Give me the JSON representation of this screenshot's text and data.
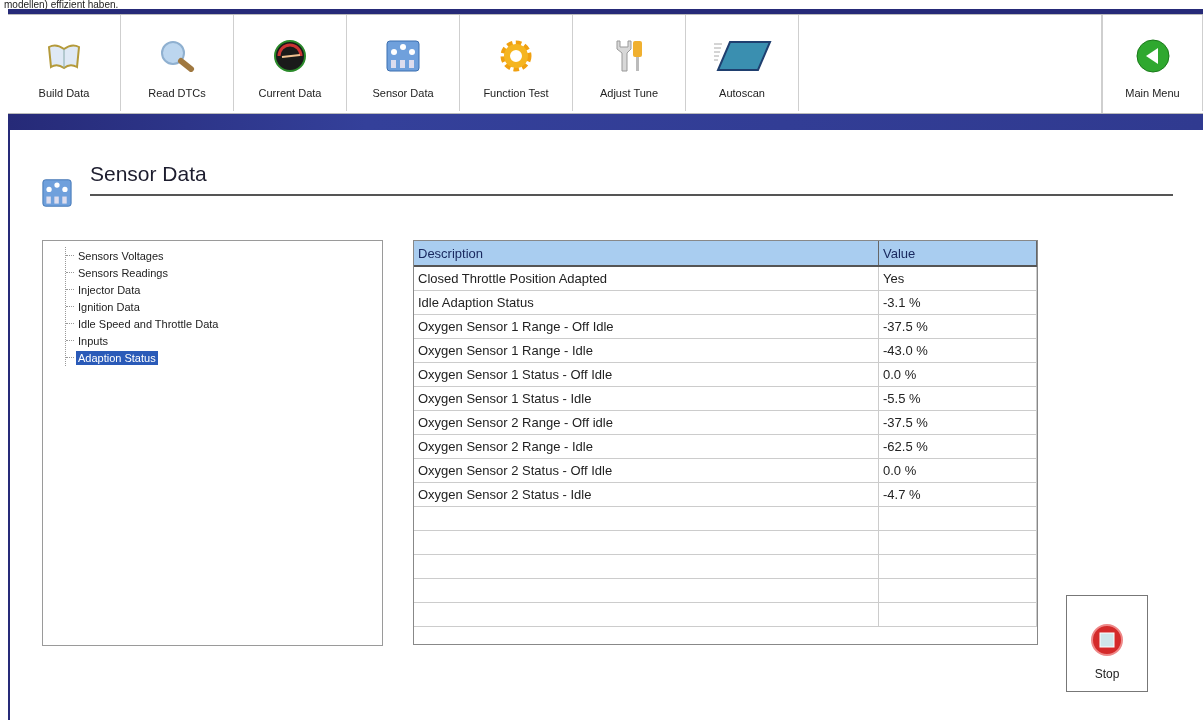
{
  "caption": "modellen) effizient haben.",
  "toolbar": [
    {
      "label": "Build Data"
    },
    {
      "label": "Read DTCs"
    },
    {
      "label": "Current Data"
    },
    {
      "label": "Sensor Data"
    },
    {
      "label": "Function Test"
    },
    {
      "label": "Adjust Tune"
    },
    {
      "label": "Autoscan"
    }
  ],
  "main_menu": {
    "label": "Main Menu"
  },
  "page_title": "Sensor Data",
  "tree": [
    {
      "label": "Sensors Voltages",
      "selected": false
    },
    {
      "label": "Sensors Readings",
      "selected": false
    },
    {
      "label": "Injector Data",
      "selected": false
    },
    {
      "label": "Ignition Data",
      "selected": false
    },
    {
      "label": "Idle Speed and Throttle Data",
      "selected": false
    },
    {
      "label": "Inputs",
      "selected": false
    },
    {
      "label": "Adaption Status",
      "selected": true
    }
  ],
  "table": {
    "columns": [
      "Description",
      "Value"
    ],
    "rows": [
      [
        "Closed Throttle Position Adapted",
        "Yes"
      ],
      [
        "Idle Adaption Status",
        "-3.1 %"
      ],
      [
        "Oxygen Sensor 1 Range - Off Idle",
        "-37.5 %"
      ],
      [
        "Oxygen Sensor 1 Range - Idle",
        "-43.0 %"
      ],
      [
        "Oxygen Sensor 1 Status - Off Idle",
        "0.0 %"
      ],
      [
        "Oxygen Sensor 1 Status - Idle",
        "-5.5 %"
      ],
      [
        "Oxygen Sensor 2 Range - Off idle",
        "-37.5 %"
      ],
      [
        "Oxygen Sensor 2 Range - Idle",
        "-62.5 %"
      ],
      [
        "Oxygen Sensor 2 Status - Off Idle",
        "0.0 %"
      ],
      [
        "Oxygen Sensor 2 Status - Idle",
        "-4.7 %"
      ]
    ]
  },
  "stop_button": {
    "label": "Stop"
  }
}
